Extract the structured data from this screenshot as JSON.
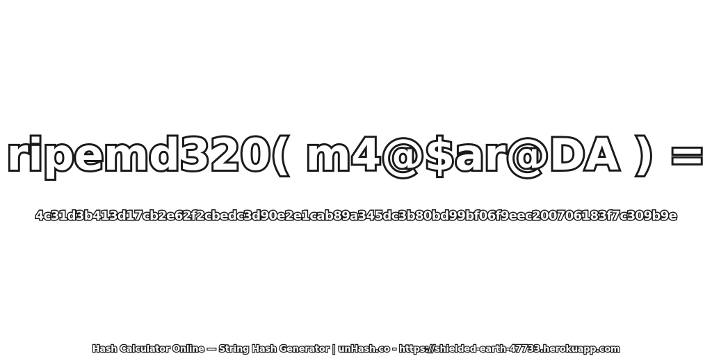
{
  "headline": "ripemd320( m4@$ar@DA ) =",
  "hash_value": "4c31d3b413d17cb2e62f2cbedc3d90e2e1cab89a345dc3b80bd99bf06f9eec200706183f7c309b9e",
  "footer": "Hash Calculator Online — String Hash Generator | unHash.co - https://shielded-earth-47733.herokuapp.com",
  "colors": {
    "background": "#ffffff",
    "text_fill": "#ffffff",
    "text_outline": "#1a1a1a"
  }
}
